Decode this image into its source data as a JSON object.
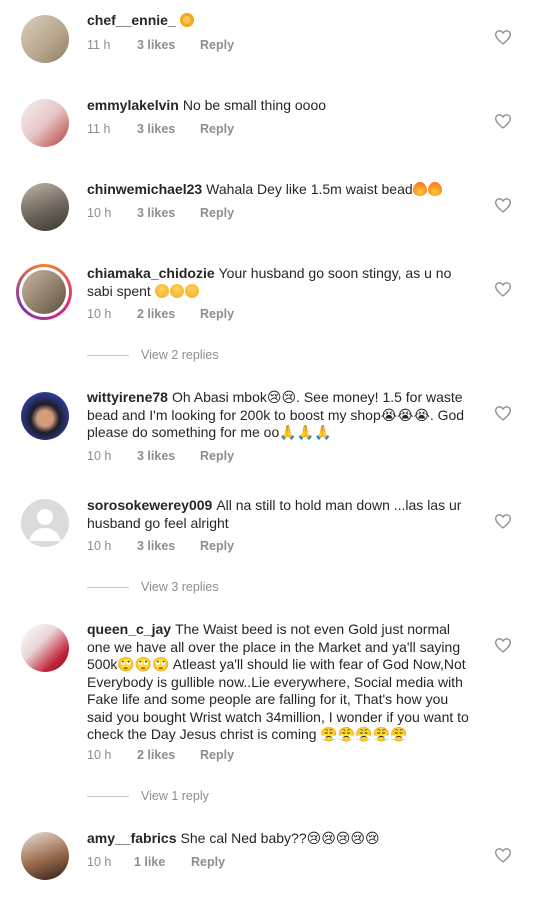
{
  "comments": [
    {
      "username": "chef__ennie_",
      "text": "",
      "emojis": [
        "heart-eyes-emoji"
      ],
      "time": "11 h",
      "likes": "3 likes",
      "reply": "Reply"
    },
    {
      "username": "emmylakelvin",
      "text": "No be small thing oooo",
      "emojis": [],
      "time": "11 h",
      "likes": "3 likes",
      "reply": "Reply"
    },
    {
      "username": "chinwemichael23",
      "text": "Wahala Dey like 1.5m waist bead",
      "emojis": [
        "fire-emoji",
        "fire-emoji"
      ],
      "time": "10 h",
      "likes": "3 likes",
      "reply": "Reply"
    },
    {
      "username": "chiamaka_chidozie",
      "text": "Your husband go soon stingy, as u no sabi spent",
      "emojis": [
        "laughing-emoji",
        "laughing-emoji",
        "laughing-emoji"
      ],
      "time": "10 h",
      "likes": "2 likes",
      "reply": "Reply",
      "view_replies": "View 2 replies"
    },
    {
      "username": "wittyirene78",
      "text": "Oh Abasi mbok😢😢. See money! 1.5 for waste bead and I'm looking for 200k to boost my shop😭😭😭. God please do something for me oo🙏🙏🙏",
      "emojis": [],
      "time": "10 h",
      "likes": "3 likes",
      "reply": "Reply"
    },
    {
      "username": "sorosokewerey009",
      "text": "All na still to hold man down ...las las ur husband go feel alright",
      "emojis": [],
      "time": "10 h",
      "likes": "3 likes",
      "reply": "Reply",
      "view_replies": "View 3 replies"
    },
    {
      "username": "queen_c_jay",
      "text": "The Waist beed is not even Gold just normal one we have all over the place in the Market and ya'll saying 500k🙄🙄🙄 Atleast ya'll should lie with fear of God Now,Not Everybody is gullible now..Lie everywhere, Social media with Fake life and some people are falling for it, That's how you said you bought Wrist watch 34million, I wonder if you want to check the Day Jesus christ is coming 😤😤😤😤😤",
      "emojis": [],
      "time": "10 h",
      "likes": "2 likes",
      "reply": "Reply",
      "view_replies": "View 1 reply"
    },
    {
      "username": "amy__fabrics",
      "text": "She cal Ned baby??😢😢😢😢😢",
      "emojis": [],
      "time": "10 h",
      "likes": "1 like",
      "reply": "Reply"
    }
  ],
  "colors": {
    "text": "#262626",
    "meta": "#8e8e8e",
    "divider": "#c7c7c7"
  }
}
